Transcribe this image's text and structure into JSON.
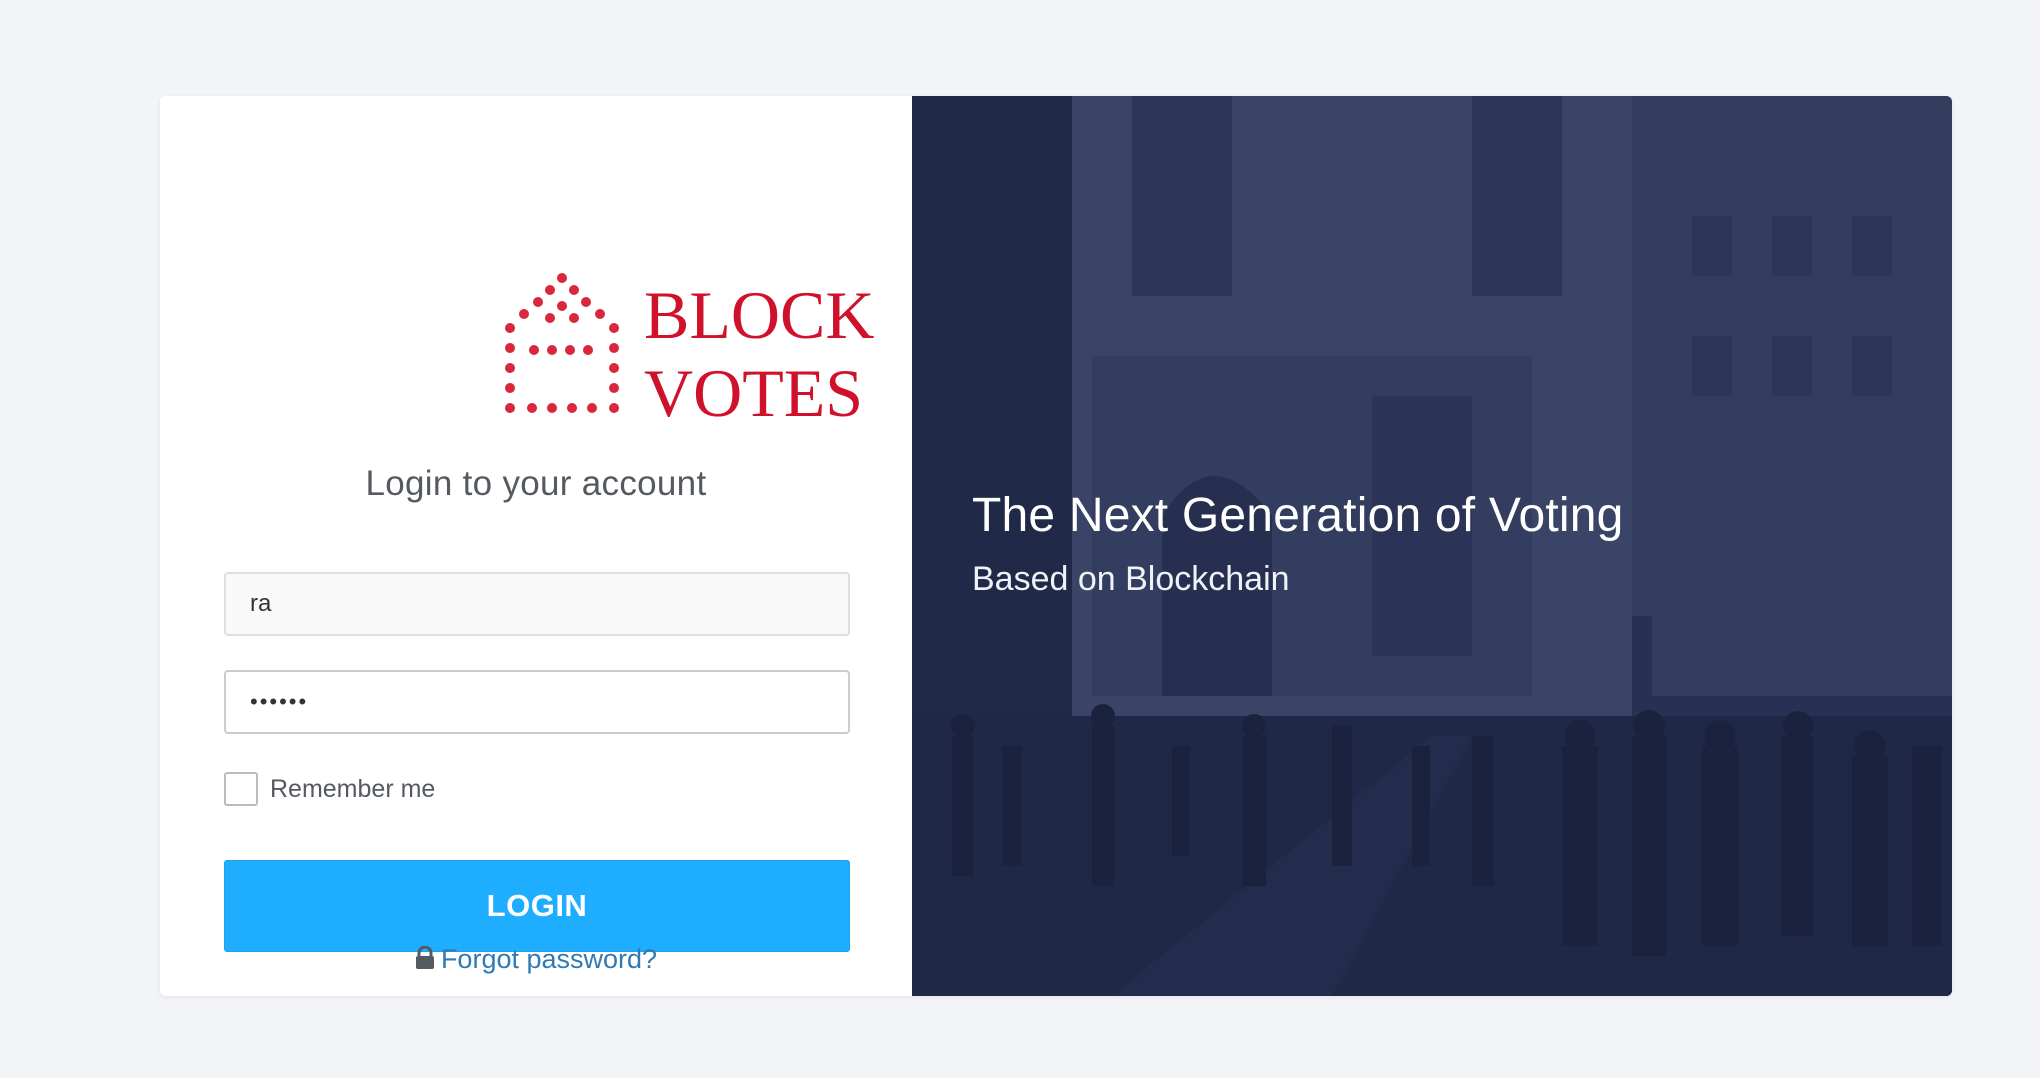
{
  "brand": {
    "name_line1": "BLOCK",
    "name_line2": "VOTES",
    "color": "#d0112b"
  },
  "login": {
    "title": "Login to your account",
    "username_value": "ra",
    "password_value": "••••••",
    "remember_label": "Remember me",
    "remember_checked": false,
    "submit_label": "LOGIN",
    "forgot_label": "Forgot password?",
    "forgot_icon": "lock-icon",
    "accent_color": "#1fadff"
  },
  "hero": {
    "title": "The Next Generation of Voting",
    "subtitle": "Based on Blockchain"
  }
}
